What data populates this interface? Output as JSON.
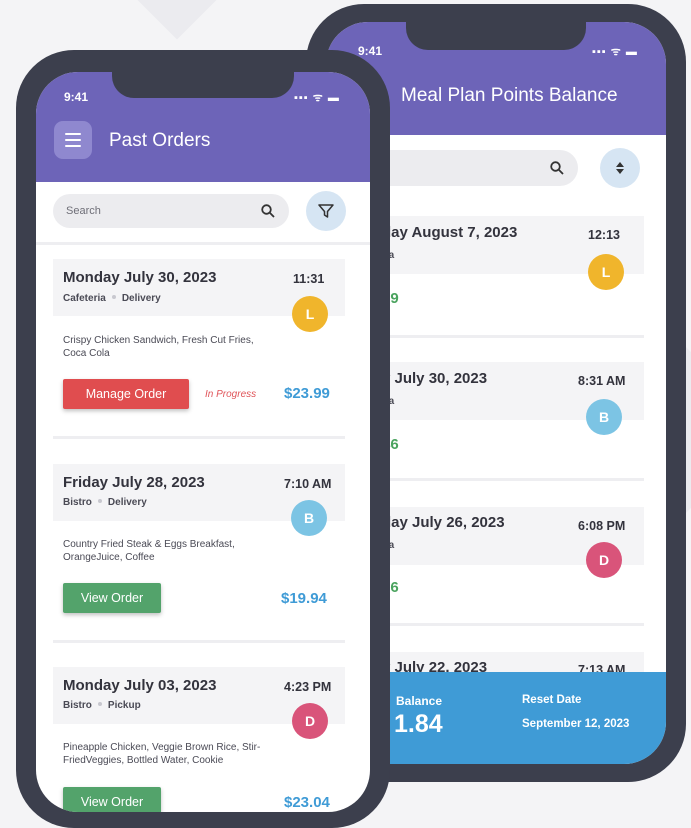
{
  "colors": {
    "accent": "#6d64b8",
    "manage": "#e04d4f",
    "view": "#53a36b",
    "price": "#3f9bd6",
    "points": "#4aa35e",
    "avatar_L": "#f0b52c",
    "avatar_B": "#7cc4e4",
    "avatar_D": "#d9547a",
    "footer": "#3f9bd6"
  },
  "back_phone": {
    "status_time": "9:41",
    "status_icons": "▪▪▪ ᯤ ▬",
    "title": "Meal Plan Points Balance",
    "search_icon": "search-icon",
    "sort_icon": "sort-icon",
    "entries": [
      {
        "date": "day August 7, 2023",
        "time": "12:13",
        "meta": "ria",
        "avatar": "L",
        "amount": "99"
      },
      {
        "date": "y July 30, 2023",
        "time": "8:31 AM",
        "meta": "ria",
        "avatar": "B",
        "amount": "46"
      },
      {
        "date": "day July 26, 2023",
        "time": "6:08 PM",
        "meta": "ria",
        "avatar": "D",
        "amount": "26"
      },
      {
        "date": "y July 22, 2023",
        "time": "7:13 AM"
      }
    ],
    "footer": {
      "balance_label": "Balance",
      "balance_value": "1.84",
      "reset_label": "Reset Date",
      "reset_value": "September 12, 2023"
    }
  },
  "front_phone": {
    "status_time": "9:41",
    "status_icons": "▪▪▪ ᯤ ▬",
    "title": "Past Orders",
    "menu_icon": "menu-icon",
    "search_placeholder": "Search",
    "search_icon": "search-icon",
    "filter_icon": "filter-icon",
    "orders": [
      {
        "date": "Monday July 30, 2023",
        "time": "11:31",
        "location": "Cafeteria",
        "mode": "Delivery",
        "avatar": "L",
        "items": "Crispy Chicken Sandwich, Fresh Cut Fries, Coca Cola",
        "button": "Manage Order",
        "status": "In Progress",
        "price": "$23.99"
      },
      {
        "date": "Friday July 28, 2023",
        "time": "7:10 AM",
        "location": "Bistro",
        "mode": "Delivery",
        "avatar": "B",
        "items": "Country Fried Steak & Eggs Breakfast, OrangeJuice, Coffee",
        "button": "View Order",
        "price": "$19.94"
      },
      {
        "date": "Monday July 03, 2023",
        "time": "4:23 PM",
        "location": "Bistro",
        "mode": "Pickup",
        "avatar": "D",
        "items": "Pineapple Chicken, Veggie Brown Rice, Stir-FriedVeggies, Bottled Water, Cookie",
        "button": "View Order",
        "price": "$23.04"
      }
    ]
  }
}
